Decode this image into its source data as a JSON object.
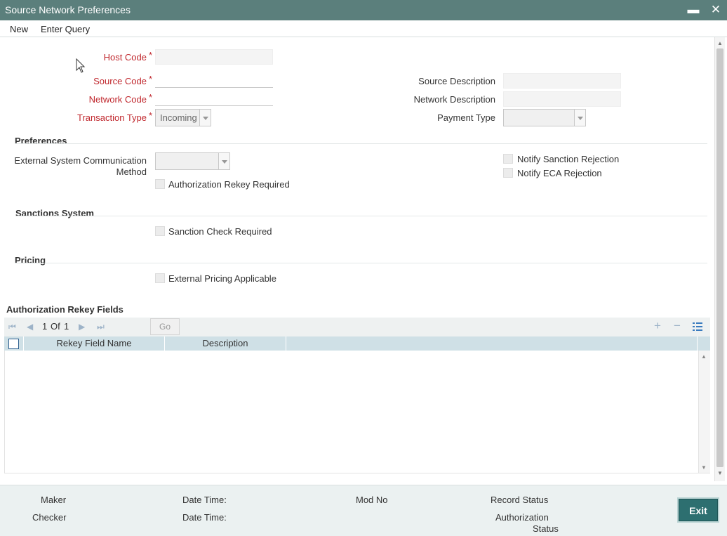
{
  "window": {
    "title": "Source Network Preferences",
    "minimize": "▬",
    "close": "✕"
  },
  "menu": {
    "new": "New",
    "enter_query": "Enter Query"
  },
  "form": {
    "host_code": {
      "label": "Host Code",
      "required": "*",
      "value": ""
    },
    "source_code": {
      "label": "Source Code",
      "required": "*",
      "value": ""
    },
    "network_code": {
      "label": "Network Code",
      "required": "*",
      "value": ""
    },
    "transaction_type": {
      "label": "Transaction Type",
      "required": "*",
      "value": "Incoming"
    },
    "source_description": {
      "label": "Source Description",
      "value": ""
    },
    "network_description": {
      "label": "Network Description",
      "value": ""
    },
    "payment_type": {
      "label": "Payment Type",
      "value": ""
    }
  },
  "preferences": {
    "heading": "Preferences",
    "ext_comm_label_1": "External System Communication",
    "ext_comm_label_2": "Method",
    "ext_comm_value": "",
    "auth_rekey": "Authorization Rekey Required",
    "notify_sanction": "Notify Sanction Rejection",
    "notify_eca": "Notify ECA Rejection"
  },
  "sanctions": {
    "heading": "Sanctions System",
    "sanction_check": "Sanction Check Required"
  },
  "pricing": {
    "heading": "Pricing",
    "external_pricing": "External Pricing Applicable"
  },
  "rekey_grid": {
    "heading": "Authorization Rekey Fields",
    "pager": {
      "current": "1",
      "of_label": "Of",
      "total": "1",
      "go": "Go"
    },
    "columns": [
      "Rekey Field Name",
      "Description"
    ],
    "rows": []
  },
  "footer": {
    "maker": "Maker",
    "checker": "Checker",
    "date_time_1": "Date Time:",
    "date_time_2": "Date Time:",
    "mod_no": "Mod No",
    "record_status": "Record Status",
    "auth_status_1": "Authorization",
    "auth_status_2": "Status",
    "exit": "Exit"
  },
  "colors": {
    "titlebar": "#5b7f7c",
    "required": "#c0272d",
    "grid_header": "#cfe0e6",
    "exit_button": "#2d6f70"
  }
}
